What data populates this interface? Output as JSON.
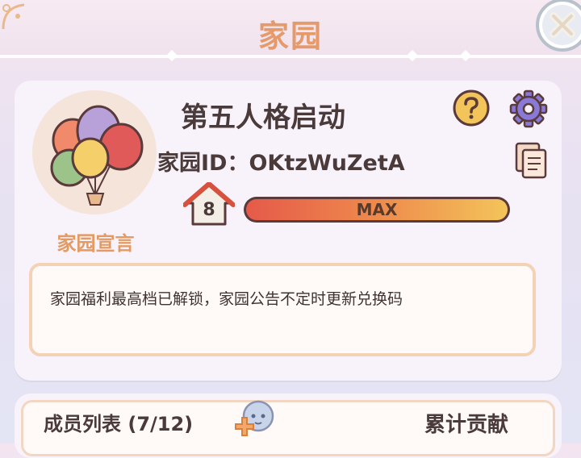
{
  "header": {
    "title": "家园"
  },
  "profile": {
    "home_name": "第五人格启动",
    "home_id": "家园ID：OKtzWuZetA",
    "avatar_caption": "家园宣言",
    "level": "8",
    "progress_label": "MAX",
    "progress_fraction": 1.0
  },
  "notice": {
    "text": "家园福利最高档已解锁，家园公告不定时更新兑换码"
  },
  "members": {
    "title": "成员列表 (7/12)",
    "contribution_label": "累计贡献"
  },
  "icons": {
    "close": "close-icon",
    "help": "question-icon",
    "settings": "gear-icon",
    "copy": "copy-icon",
    "level": "house-icon",
    "add_member": "add-friend-icon"
  },
  "colors": {
    "title": "#e59a6c",
    "text": "#4a3a3a",
    "accent_orange": "#ee8a4c",
    "help_yellow": "#f3c45a",
    "settings_purple": "#8a7ad8"
  }
}
